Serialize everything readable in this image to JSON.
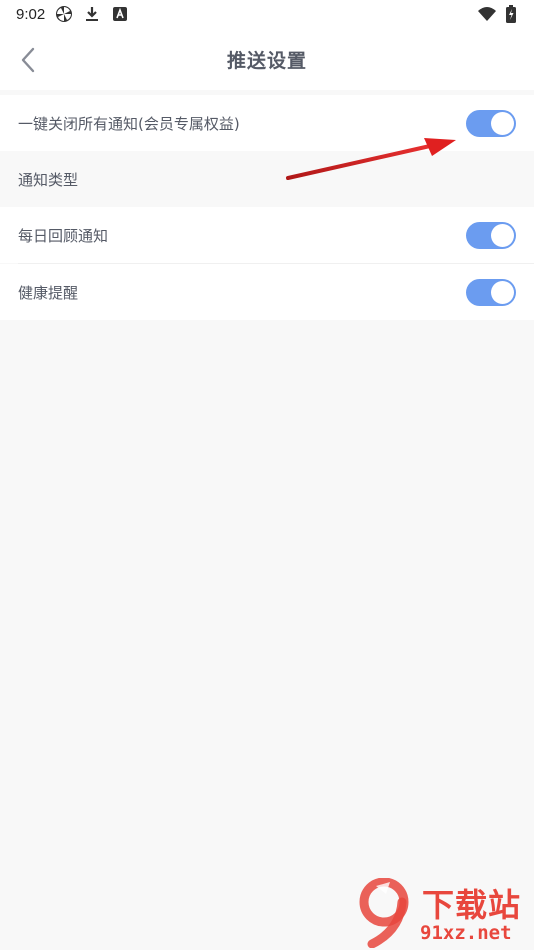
{
  "status_bar": {
    "time": "9:02",
    "icons_left": [
      "pinwheel-icon",
      "download-icon",
      "a-badge-icon"
    ],
    "icons_right": [
      "wifi-icon",
      "battery-charging-icon"
    ]
  },
  "header": {
    "title": "推送设置",
    "back_icon": "chevron-left-icon"
  },
  "settings": {
    "master_toggle": {
      "label": "一键关闭所有通知(会员专属权益)",
      "on": true
    },
    "section_title": "通知类型",
    "items": [
      {
        "label": "每日回顾通知",
        "on": true
      },
      {
        "label": "健康提醒",
        "on": true
      }
    ]
  },
  "colors": {
    "toggle_on": "#6b9cf0",
    "annotation_arrow": "#e02020",
    "watermark": "#e8473d"
  },
  "watermark": {
    "logo_glyph": "9",
    "brand": "下载站",
    "domain": "91xz.net"
  }
}
